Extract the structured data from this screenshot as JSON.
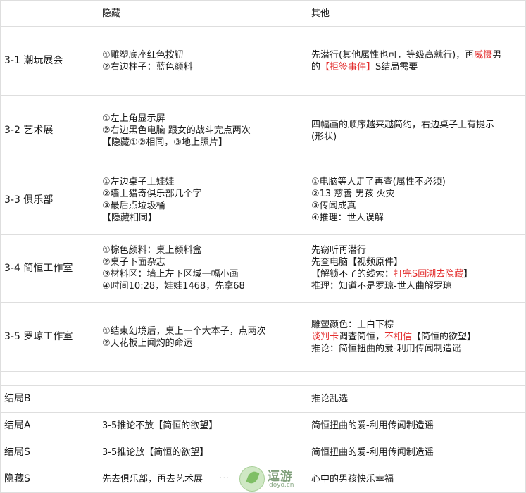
{
  "header": {
    "stage": "",
    "hidden": "隐藏",
    "other": "其他"
  },
  "rows": [
    {
      "stage": "3-1 潮玩展会",
      "hidden": [
        "①雕塑底座红色按钮",
        "②右边柱子：蓝色颜料"
      ],
      "other_l1_a": "先潜行(其他属性也可，等级高就行)，再",
      "other_l1_red": "威慑",
      "other_l1_b": "男",
      "other_l2_a": "的",
      "other_l2_red": "【拒签事件】",
      "other_l2_b": "S结局需要"
    },
    {
      "stage": "3-2 艺术展",
      "hidden": [
        "①左上角显示屏",
        "②右边黑色电脑 跟女的战斗完点两次",
        "【隐藏①②相同，③地上照片】"
      ],
      "other": [
        "四幅画的顺序越来越简约，右边桌子上有提示",
        "(形状)"
      ]
    },
    {
      "stage": "3-3 俱乐部",
      "hidden": [
        "①左边桌子上娃娃",
        "②墙上猎奇俱乐部几个字",
        "③最后点垃圾桶",
        "【隐藏相同】"
      ],
      "other": [
        "①电脑等人走了再查(属性不必须)",
        "②13 慈善 男孩 火灾",
        "③传闻成真",
        "④推理：世人误解"
      ]
    },
    {
      "stage": "3-4 简恒工作室",
      "hidden": [
        "①棕色颜料：桌上颜料盒",
        "②桌子下面杂志",
        "③材料区：墙上左下区域一幅小画",
        "④时间10:28，娃娃1468，先拿68"
      ],
      "other_l1": "先窃听再潜行",
      "other_l2": "先查电脑【视频原件】",
      "other_l3_a": "【解锁不了的线索：",
      "other_l3_red": "打完S回溯去隐藏",
      "other_l3_b": "】",
      "other_l4": "推理：知道不是罗琼-世人曲解罗琼"
    },
    {
      "stage": "3-5 罗琼工作室",
      "hidden": [
        "①结束幻境后，桌上一个大本子，点两次",
        "②天花板上闻灼的命运"
      ],
      "other_l1": "雕塑颜色：上白下棕",
      "other_l2_red1": "谈判卡",
      "other_l2_a": "调查简恒，",
      "other_l2_red2": "不相信",
      "other_l2_b": "【简恒的欲望】",
      "other_l3": "推论：简恒扭曲的爱-利用传闻制造谣"
    }
  ],
  "endings": [
    {
      "stage": "结局B",
      "hidden": "",
      "other": "推论乱选"
    },
    {
      "stage": "结局A",
      "hidden": "3-5推论不放【简恒的欲望】",
      "other": "简恒扭曲的爱-利用传闻制造谣"
    },
    {
      "stage": "结局S",
      "hidden": "3-5推论放【简恒的欲望】",
      "other": "简恒扭曲的爱-利用传闻制造谣"
    },
    {
      "stage": "隐藏S",
      "hidden": "先去俱乐部，再去艺术展",
      "other": "心中的男孩快乐幸福"
    }
  ],
  "watermark": {
    "brand": "逗游",
    "domain": "doyo.cn"
  },
  "colors": {
    "highlight": "#e32b2b",
    "border": "#dedede"
  }
}
